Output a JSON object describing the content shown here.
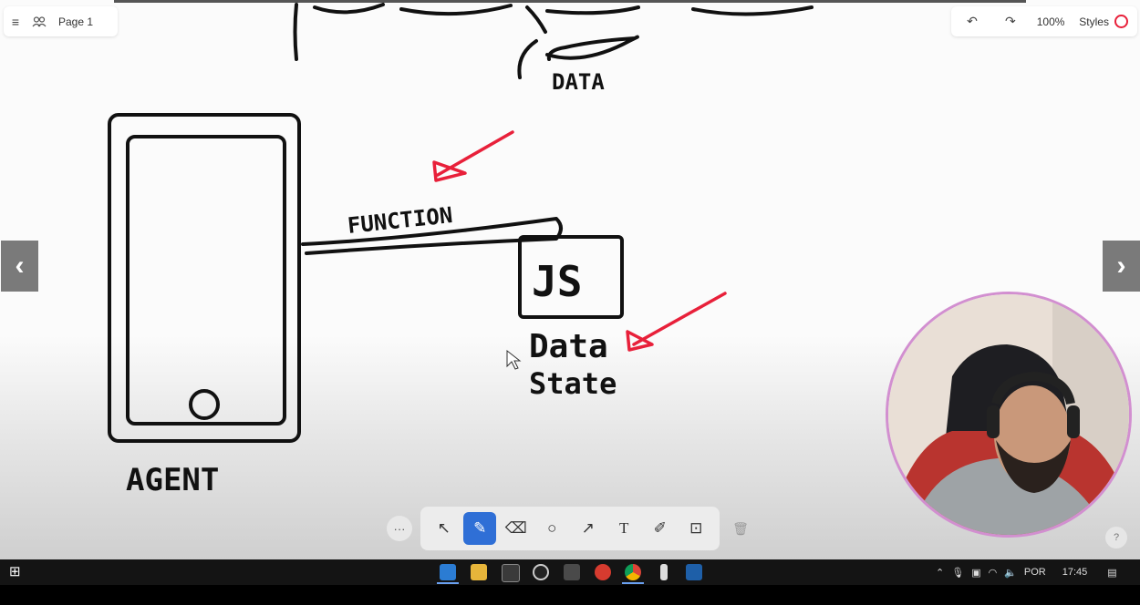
{
  "toolbar_top_left": {
    "page_label": "Page 1"
  },
  "toolbar_top_right": {
    "zoom": "100%",
    "styles_label": "Styles",
    "accent_color": "#e8203a"
  },
  "drawing_labels": {
    "data_top": "DATA",
    "function": "FUNCTION",
    "js": "JS",
    "data": "Data",
    "state": "State",
    "agent": "AGENT"
  },
  "drawing_tools": [
    {
      "name": "select",
      "icon": "cursor-icon",
      "active": false
    },
    {
      "name": "draw",
      "icon": "pencil-icon",
      "active": true
    },
    {
      "name": "eraser",
      "icon": "eraser-icon",
      "active": false
    },
    {
      "name": "ellipse",
      "icon": "circle-icon",
      "active": false
    },
    {
      "name": "arrow",
      "icon": "arrow-icon",
      "active": false
    },
    {
      "name": "text",
      "icon": "text-icon",
      "active": false
    },
    {
      "name": "sticky",
      "icon": "sticky-note-icon",
      "active": false
    },
    {
      "name": "image",
      "icon": "image-icon",
      "active": false
    }
  ],
  "help": "?",
  "taskbar": {
    "language": "POR",
    "time": "17:45",
    "apps": [
      "vscode-icon",
      "file-explorer-icon",
      "terminal-icon",
      "github-icon",
      "folder-icon",
      "app-icon",
      "chrome-icon",
      "phone-icon",
      "app2-icon"
    ]
  }
}
